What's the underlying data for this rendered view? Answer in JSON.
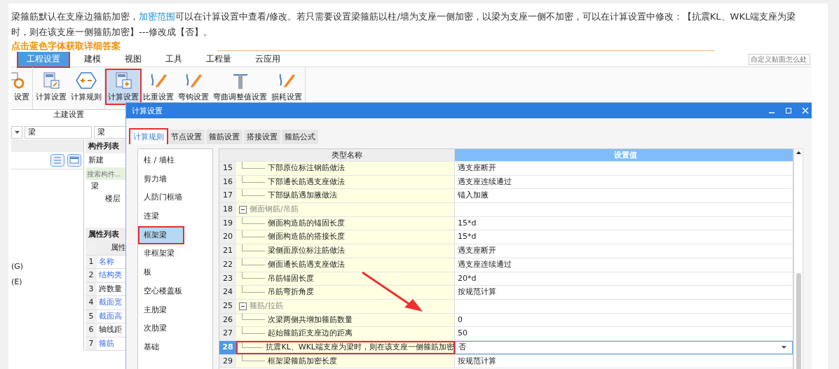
{
  "article": {
    "text_before": "梁箍筋默认在支座边箍筋加密，",
    "link": "加密范围",
    "text_after": "可以在计算设置中查看/修改。若只需要设置梁箍筋以柱/墙为支座一侧加密，以梁为支座一侧不加密，可以在计算设置中修改：【抗震KL、WKL端支座为梁时，则在该支座一侧箍筋加密】---修改成【否】。",
    "cta": "点击蓝色字体获取详细答案"
  },
  "search": {
    "placeholder": "自定义贴面怎么处"
  },
  "menu": [
    {
      "label": "工程设置",
      "selected": true,
      "annotated": true
    },
    {
      "label": "建模",
      "selected": false,
      "annotated": false
    },
    {
      "label": "视图",
      "selected": false,
      "annotated": false
    },
    {
      "label": "工具",
      "selected": false,
      "annotated": false
    },
    {
      "label": "工程量",
      "selected": false,
      "annotated": false
    },
    {
      "label": "云应用",
      "selected": false,
      "annotated": false
    }
  ],
  "ribbon": {
    "groups": [
      {
        "buttons": [
          {
            "label": "设置",
            "selected": false,
            "annotated": false
          }
        ]
      },
      {
        "label": "土建设置",
        "buttons": [
          {
            "label": "计算设置",
            "selected": false,
            "annotated": false
          },
          {
            "label": "计算规则",
            "selected": false,
            "annotated": false
          }
        ]
      },
      {
        "buttons": [
          {
            "label": "计算设置",
            "selected": true,
            "annotated": true
          },
          {
            "label": "比重设置",
            "selected": false,
            "annotated": false
          },
          {
            "label": "弯钩设置",
            "selected": false,
            "annotated": false
          },
          {
            "label": "弯曲调整值设置",
            "selected": false,
            "annotated": false
          },
          {
            "label": "损耗设置",
            "selected": false,
            "annotated": false
          }
        ]
      }
    ]
  },
  "filters": [
    "梁",
    "梁"
  ],
  "side_panel": {
    "items": [
      {
        "label": "(G)",
        "selected": false
      },
      {
        "label": "(E)",
        "selected": false
      }
    ]
  },
  "component_list": {
    "title": "构件列表",
    "new_button": "新建",
    "search_placeholder": "搜索构件...",
    "tree": [
      {
        "label": "梁",
        "children": [
          {
            "label": "楼层"
          }
        ]
      }
    ]
  },
  "property_list": {
    "title": "属性列表",
    "header": "属性",
    "rows": [
      {
        "no": "1",
        "name": "名称",
        "linked": true
      },
      {
        "no": "2",
        "name": "结构类",
        "linked": true
      },
      {
        "no": "3",
        "name": "跨数量",
        "linked": false
      },
      {
        "no": "4",
        "name": "截面宽",
        "linked": true
      },
      {
        "no": "5",
        "name": "截面高",
        "linked": true
      },
      {
        "no": "6",
        "name": "轴线距",
        "linked": false
      },
      {
        "no": "7",
        "name": "箍筋",
        "linked": true
      }
    ]
  },
  "dialog": {
    "title": "计算设置",
    "tabs": [
      {
        "label": "计算规则",
        "selected": true,
        "annotated": true
      },
      {
        "label": "节点设置",
        "selected": false,
        "annotated": false
      },
      {
        "label": "箍筋设置",
        "selected": false,
        "annotated": false
      },
      {
        "label": "搭接设置",
        "selected": false,
        "annotated": false
      },
      {
        "label": "箍筋公式",
        "selected": false,
        "annotated": false
      }
    ],
    "categories": [
      {
        "label": "柱 / 墙柱",
        "selected": false,
        "annotated": false
      },
      {
        "label": "剪力墙",
        "selected": false,
        "annotated": false
      },
      {
        "label": "人防门框墙",
        "selected": false,
        "annotated": false
      },
      {
        "label": "连梁",
        "selected": false,
        "annotated": false
      },
      {
        "label": "框架梁",
        "selected": true,
        "annotated": true
      },
      {
        "label": "非框架梁",
        "selected": false,
        "annotated": false
      },
      {
        "label": "板",
        "selected": false,
        "annotated": false
      },
      {
        "label": "空心楼盖板",
        "selected": false,
        "annotated": false
      },
      {
        "label": "主肋梁",
        "selected": false,
        "annotated": false
      },
      {
        "label": "次肋梁",
        "selected": false,
        "annotated": false
      },
      {
        "label": "基础",
        "selected": false,
        "annotated": false
      }
    ],
    "table": {
      "columns": [
        "类型名称",
        "设置值"
      ],
      "rows": [
        {
          "no": "15",
          "kind": "item",
          "name": "下部原位标注钢筋做法",
          "value": "遇支座断开",
          "selected": false,
          "annotated": false
        },
        {
          "no": "16",
          "kind": "item",
          "name": "下部通长筋遇支座做法",
          "value": "遇支座连续通过",
          "selected": false,
          "annotated": false
        },
        {
          "no": "17",
          "kind": "item",
          "name": "下部纵筋遇加腋做法",
          "value": "锚入加腋",
          "selected": false,
          "annotated": false
        },
        {
          "no": "18",
          "kind": "group",
          "name": "侧面钢筋/吊筋",
          "value": "",
          "selected": false,
          "annotated": false
        },
        {
          "no": "19",
          "kind": "item",
          "name": "侧面构造筋的锚固长度",
          "value": "15*d",
          "selected": false,
          "annotated": false
        },
        {
          "no": "20",
          "kind": "item",
          "name": "侧面构造筋的搭接长度",
          "value": "15*d",
          "selected": false,
          "annotated": false
        },
        {
          "no": "21",
          "kind": "item",
          "name": "梁侧面原位标注筋做法",
          "value": "遇支座断开",
          "selected": false,
          "annotated": false
        },
        {
          "no": "22",
          "kind": "item",
          "name": "侧面通长筋遇支座做法",
          "value": "遇支座连续通过",
          "selected": false,
          "annotated": false
        },
        {
          "no": "23",
          "kind": "item",
          "name": "吊筋锚固长度",
          "value": "20*d",
          "selected": false,
          "annotated": false
        },
        {
          "no": "24",
          "kind": "item",
          "name": "吊筋弯折角度",
          "value": "按规范计算",
          "selected": false,
          "annotated": false
        },
        {
          "no": "25",
          "kind": "group",
          "name": "箍筋/拉筋",
          "value": "",
          "selected": false,
          "annotated": false
        },
        {
          "no": "26",
          "kind": "item",
          "name": "次梁两侧共增加箍筋数量",
          "value": "0",
          "selected": false,
          "annotated": false
        },
        {
          "no": "27",
          "kind": "item",
          "name": "起始箍筋距支座边的距离",
          "value": "50",
          "selected": false,
          "annotated": false
        },
        {
          "no": "28",
          "kind": "item",
          "name": "抗震KL、WKL端支座为梁时，则在该支座一侧箍筋加密",
          "value": "否",
          "selected": true,
          "annotated": true
        },
        {
          "no": "29",
          "kind": "item",
          "name": "框架梁箍筋加密长度",
          "value": "按规范计算",
          "selected": false,
          "annotated": false
        }
      ]
    }
  }
}
